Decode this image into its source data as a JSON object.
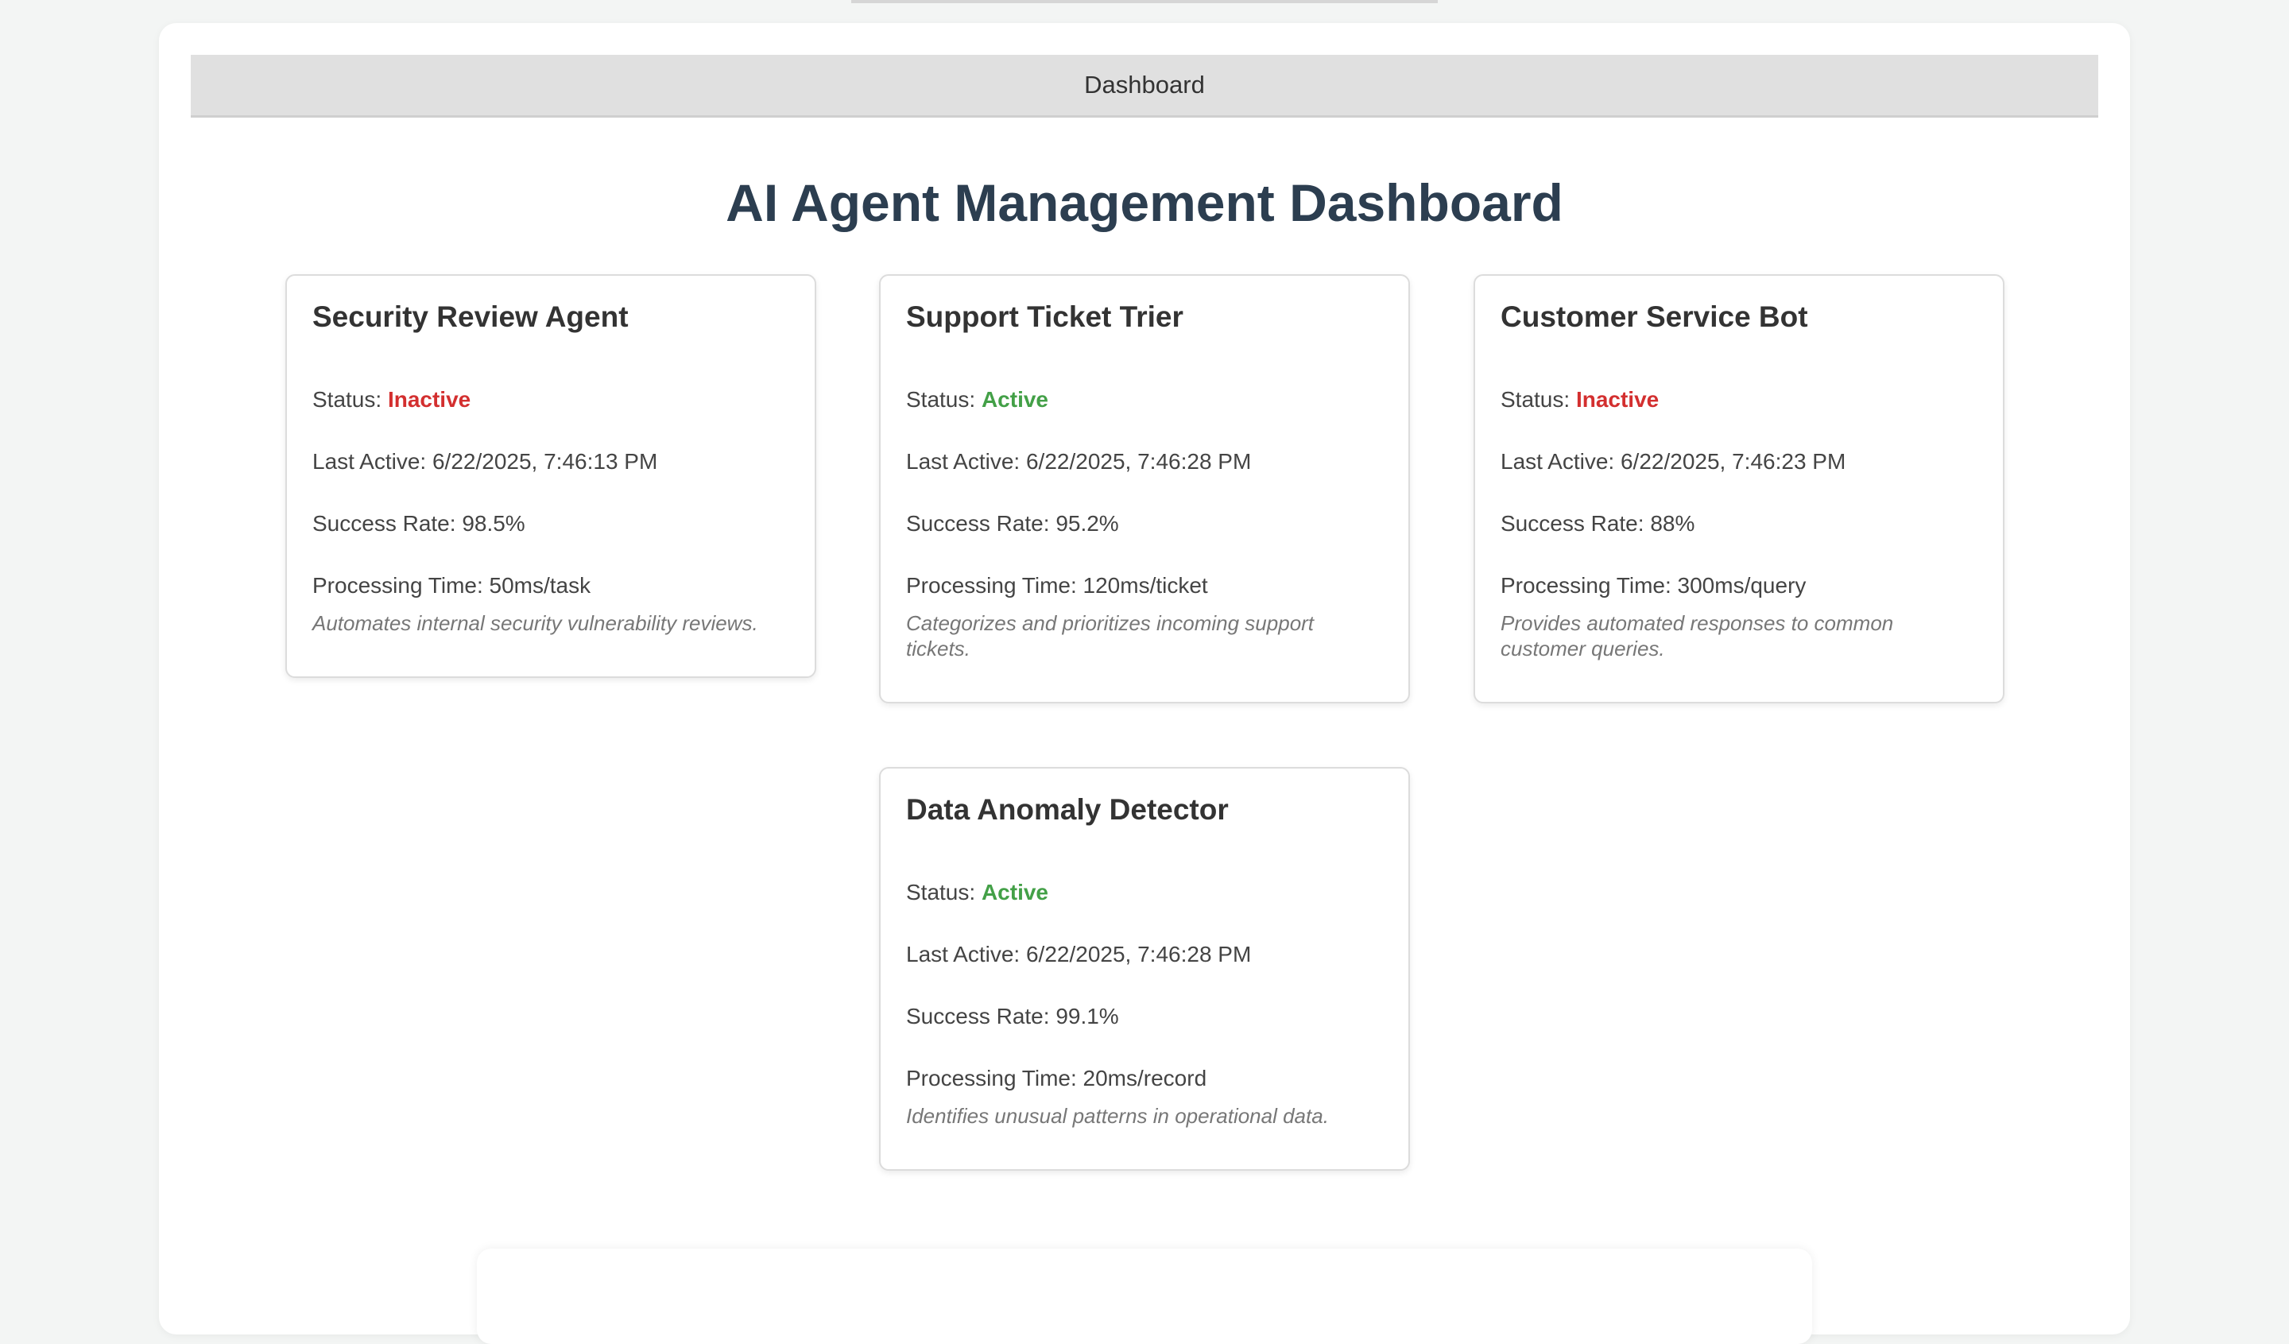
{
  "tab": {
    "label": "Dashboard"
  },
  "page": {
    "title": "AI Agent Management Dashboard"
  },
  "labels": {
    "status": "Status:",
    "last_active": "Last Active:",
    "success_rate": "Success Rate:",
    "processing_time": "Processing Time:"
  },
  "colors": {
    "active": "#43a047",
    "inactive": "#d32f2f",
    "title": "#2c3e50"
  },
  "agents": [
    {
      "name": "Security Review Agent",
      "status": "Inactive",
      "last_active": "6/22/2025, 7:46:13 PM",
      "success_rate": "98.5%",
      "processing_time": "50ms/task",
      "description": "Automates internal security vulnerability reviews."
    },
    {
      "name": "Support Ticket Trier",
      "status": "Active",
      "last_active": "6/22/2025, 7:46:28 PM",
      "success_rate": "95.2%",
      "processing_time": "120ms/ticket",
      "description": "Categorizes and prioritizes incoming support tickets."
    },
    {
      "name": "Customer Service Bot",
      "status": "Inactive",
      "last_active": "6/22/2025, 7:46:23 PM",
      "success_rate": "88%",
      "processing_time": "300ms/query",
      "description": "Provides automated responses to common customer queries."
    },
    {
      "name": "Data Anomaly Detector",
      "status": "Active",
      "last_active": "6/22/2025, 7:46:28 PM",
      "success_rate": "99.1%",
      "processing_time": "20ms/record",
      "description": "Identifies unusual patterns in operational data."
    }
  ]
}
